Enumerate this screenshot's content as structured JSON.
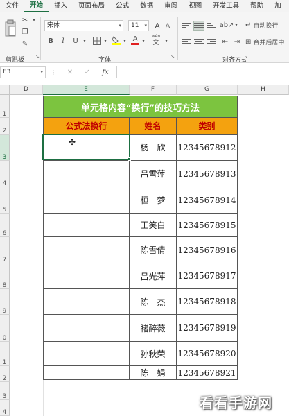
{
  "menu": [
    "文件",
    "开始",
    "插入",
    "页面布局",
    "公式",
    "数据",
    "审阅",
    "视图",
    "开发工具",
    "帮助",
    "加"
  ],
  "menu_active_index": 1,
  "ribbon": {
    "font_name": "宋体",
    "font_size": "11",
    "bold": "B",
    "italic": "I",
    "underline": "U",
    "clipboard_label": "剪贴板",
    "font_label": "字体",
    "align_label": "对齐方式",
    "wrap_text": "自动换行",
    "merge_center": "合并后居中",
    "grow_font": "A",
    "shrink_font": "A",
    "font_color_glyph": "A",
    "wen_glyph": "wén"
  },
  "formula_bar": {
    "name_box": "E3",
    "cancel": "✕",
    "confirm": "✓",
    "fx": "fx",
    "content": ""
  },
  "columns": [
    "D",
    "E",
    "F",
    "G",
    "H"
  ],
  "selected_column": "E",
  "rows": [
    "1",
    "2",
    "3",
    "4",
    "5",
    "6",
    "7",
    "8",
    "9",
    "0",
    "1",
    "2",
    "3",
    "4"
  ],
  "selected_row_index": 2,
  "table": {
    "title": "单元格内容“换行”的技巧方法",
    "headers": [
      "公式法换行",
      "姓名",
      "类别"
    ],
    "records": [
      {
        "name": "杨　欣",
        "id": "12345678912"
      },
      {
        "name": "吕雪萍",
        "id": "12345678913"
      },
      {
        "name": "桓　梦",
        "id": "12345678914"
      },
      {
        "name": "王笑白",
        "id": "12345678915"
      },
      {
        "name": "陈雪倩",
        "id": "12345678916"
      },
      {
        "name": "吕光萍",
        "id": "12345678917"
      },
      {
        "name": "陈　杰",
        "id": "12345678918"
      },
      {
        "name": "褚醉薇",
        "id": "12345678919"
      },
      {
        "name": "孙秋荣",
        "id": "12345678920"
      },
      {
        "name": "陈　娟",
        "id": "12345678921"
      }
    ]
  },
  "watermark": "看看手游网",
  "colors": {
    "title_bg": "#7cc43f",
    "header_bg": "#f4a20f",
    "header_text": "#c00000",
    "excel_green": "#1d6f42"
  }
}
